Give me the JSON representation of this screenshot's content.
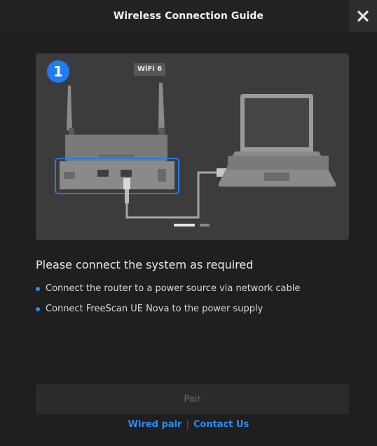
{
  "dialog": {
    "title": "Wireless Connection Guide"
  },
  "illustration": {
    "step_number": "1",
    "router_label": "WiFi 6",
    "pager": {
      "current": 1,
      "total": 2
    }
  },
  "instructions": {
    "heading": "Please connect the system as required",
    "items": [
      "Connect the router to a power source via network cable",
      "Connect FreeScan UE Nova to the power supply"
    ]
  },
  "footer": {
    "pair_label": "Pair",
    "wired_pair_label": "Wired pair",
    "separator": "|",
    "contact_label": "Contact Us"
  },
  "colors": {
    "accent": "#1f7cf2",
    "link": "#2c8cf4",
    "background": "#1f1f1f"
  },
  "icons": [
    "close-icon",
    "router-icon",
    "laptop-icon",
    "network-cable-icon"
  ]
}
